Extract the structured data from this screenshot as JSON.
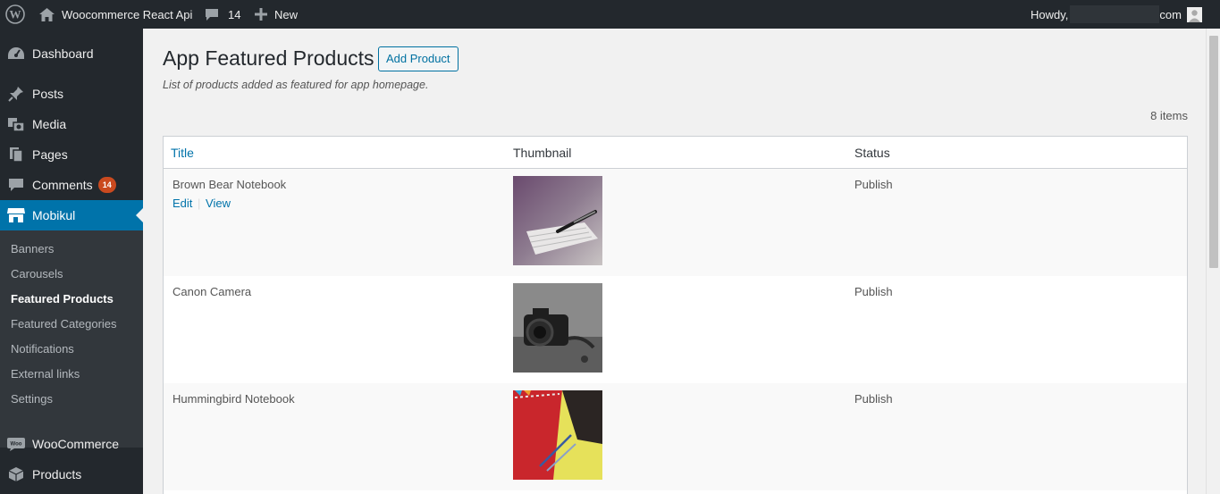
{
  "admin_bar": {
    "site_name": "Woocommerce React Api",
    "comments_count": "14",
    "new_label": "New",
    "howdy_prefix": "Howdy,",
    "howdy_suffix": "com"
  },
  "sidebar": {
    "items": [
      {
        "label": "Dashboard",
        "icon": "dashboard-icon"
      },
      {
        "label": "Posts",
        "icon": "pin-icon"
      },
      {
        "label": "Media",
        "icon": "media-icon"
      },
      {
        "label": "Pages",
        "icon": "pages-icon"
      },
      {
        "label": "Comments",
        "icon": "comment-icon",
        "badge": "14"
      },
      {
        "label": "Mobikul",
        "icon": "store-icon"
      },
      {
        "label": "WooCommerce",
        "icon": "woo-icon"
      },
      {
        "label": "Products",
        "icon": "box-icon"
      }
    ],
    "submenu": [
      "Banners",
      "Carousels",
      "Featured Products",
      "Featured Categories",
      "Notifications",
      "External links",
      "Settings"
    ]
  },
  "main": {
    "title": "App Featured Products",
    "add_button": "Add Product",
    "subtitle": "List of products added as featured for app homepage.",
    "items_count": "8 items"
  },
  "table": {
    "headers": {
      "title": "Title",
      "thumbnail": "Thumbnail",
      "status": "Status"
    },
    "row_actions": {
      "edit": "Edit",
      "separator": "|",
      "view": "View"
    },
    "rows": [
      {
        "title": "Brown Bear Notebook",
        "status": "Publish",
        "thumbnail": "notebook-pen-photo"
      },
      {
        "title": "Canon Camera",
        "status": "Publish",
        "thumbnail": "camera-photo"
      },
      {
        "title": "Hummingbird Notebook",
        "status": "Publish",
        "thumbnail": "red-notebook-photo"
      }
    ]
  },
  "colors": {
    "admin_dark": "#23282d",
    "submenu_bg": "#32373c",
    "accent": "#0073aa",
    "badge": "#ca4a1f"
  }
}
